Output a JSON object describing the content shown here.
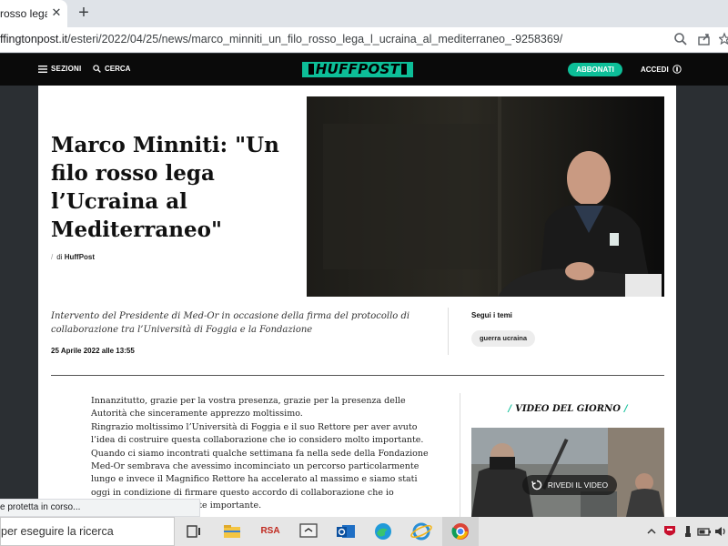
{
  "browser": {
    "tab_title": "rosso lega",
    "tab_close": "✕",
    "new_tab": "+",
    "url_host": "ffingtonpost.it",
    "url_path": "/esteri/2022/04/25/news/marco_minniti_un_filo_rosso_lega_l_ucraina_al_mediterraneo_-9258369/",
    "status_text": "e protetta in corso..."
  },
  "header": {
    "sections_label": "SEZIONI",
    "search_label": "CERCA",
    "logo_text": "HUFFPOST",
    "subscribe_label": "ABBONATI",
    "login_label": "ACCEDI",
    "colors": {
      "brand": "#0dbe98",
      "bar": "#0a0a0a"
    }
  },
  "article": {
    "headline": "Marco Minniti: \"Un filo rosso lega l’Ucraina al Mediterraneo\"",
    "byline_prefix": "di",
    "byline_author": "HuffPost",
    "subtitle": "Intervento del Presidente di Med-Or in occasione della firma del protocollo di collaborazione tra l’Università di Foggia e la Fondazione",
    "date": "25 Aprile 2022 alle 13:55",
    "paragraphs": [
      "Innanzitutto, grazie per la vostra presenza, grazie per la presenza delle Autorità che sinceramente apprezzo moltissimo.",
      "Ringrazio moltissimo l’Università di Foggia e il suo Rettore per aver avuto l’idea di costruire questa collaborazione che io considero molto importante.",
      "Quando ci siamo incontrati qualche settimana fa nella sede della Fondazione Med-Or sembrava che avessimo incominciato un percorso particolarmente lungo e invece il Magnifico Rettore ha accelerato al massimo e siamo stati oggi in condizione di firmare questo accordo di collaborazione che io considero particolarmente importante."
    ]
  },
  "sidebar": {
    "follow_label": "Segui i temi",
    "tag": "guerra ucraina",
    "video_title": "VIDEO DEL GIORNO",
    "replay_label": "RIVEDI IL VIDEO"
  },
  "taskbar": {
    "search_text": "per eseguire la ricerca",
    "rsa_label": "RSA"
  }
}
